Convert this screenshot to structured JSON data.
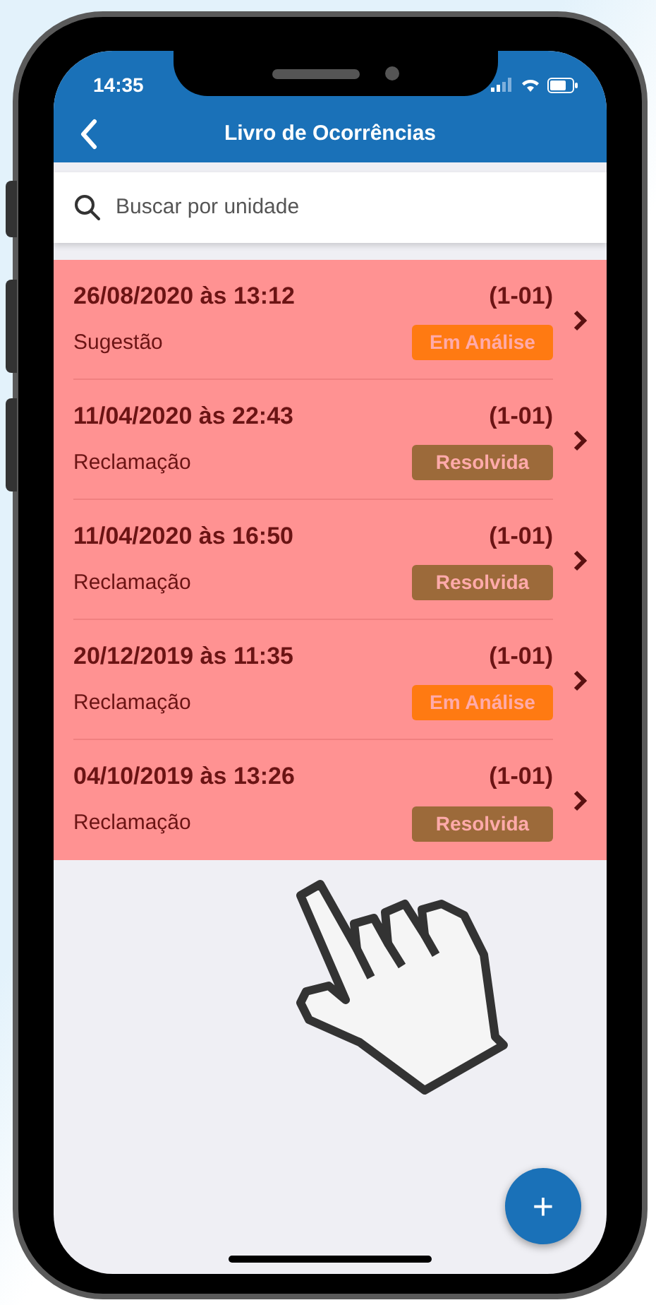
{
  "status_bar": {
    "time": "14:35"
  },
  "header": {
    "title": "Livro de Ocorrências"
  },
  "search": {
    "placeholder": "Buscar por unidade"
  },
  "occurrences": [
    {
      "datetime": "26/08/2020 às 13:12",
      "unit": "(1-01)",
      "type": "Sugestão",
      "status": {
        "label": "Em Análise",
        "color": "#ff7a12"
      }
    },
    {
      "datetime": "11/04/2020 às 22:43",
      "unit": "(1-01)",
      "type": "Reclamação",
      "status": {
        "label": "Resolvida",
        "color": "#9c6a3a"
      }
    },
    {
      "datetime": "11/04/2020 às 16:50",
      "unit": "(1-01)",
      "type": "Reclamação",
      "status": {
        "label": "Resolvida",
        "color": "#9c6a3a"
      }
    },
    {
      "datetime": "20/12/2019 às 11:35",
      "unit": "(1-01)",
      "type": "Reclamação",
      "status": {
        "label": "Em Análise",
        "color": "#ff7a12"
      }
    },
    {
      "datetime": "04/10/2019 às 13:26",
      "unit": "(1-01)",
      "type": "Reclamação",
      "status": {
        "label": "Resolvida",
        "color": "#9c6a3a"
      }
    }
  ],
  "fab": {
    "label": "+"
  }
}
